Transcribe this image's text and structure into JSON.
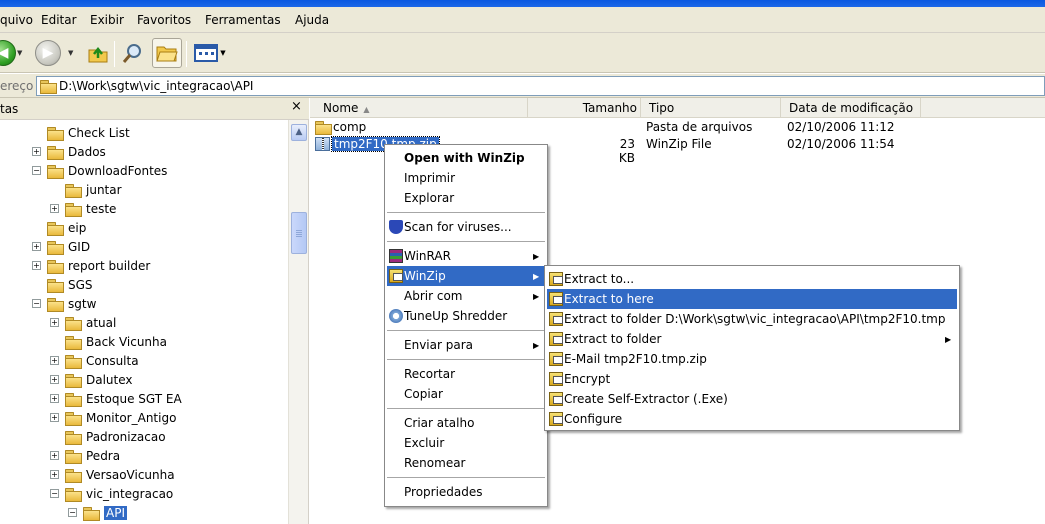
{
  "menubar": {
    "items": [
      "quivo",
      "Editar",
      "Exibir",
      "Favoritos",
      "Ferramentas",
      "Ajuda"
    ]
  },
  "toolbar": {
    "icons": [
      "back-icon",
      "forward-icon",
      "up-folder-icon",
      "search-icon",
      "folders-icon",
      "views-icon"
    ]
  },
  "address": {
    "label": "ereço",
    "value": "D:\\Work\\sgtw\\vic_integracao\\API"
  },
  "left_pane": {
    "title": "tas",
    "close_glyph": "×",
    "tree": [
      {
        "label": "Check List",
        "level": 0,
        "expander": ""
      },
      {
        "label": "Dados",
        "level": 0,
        "expander": "+"
      },
      {
        "label": "DownloadFontes",
        "level": 0,
        "expander": "−"
      },
      {
        "label": "juntar",
        "level": 1,
        "expander": ""
      },
      {
        "label": "teste",
        "level": 1,
        "expander": "+"
      },
      {
        "label": "eip",
        "level": 0,
        "expander": ""
      },
      {
        "label": "GID",
        "level": 0,
        "expander": "+"
      },
      {
        "label": "report builder",
        "level": 0,
        "expander": "+"
      },
      {
        "label": "SGS",
        "level": 0,
        "expander": ""
      },
      {
        "label": "sgtw",
        "level": 0,
        "expander": "−"
      },
      {
        "label": "atual",
        "level": 1,
        "expander": "+"
      },
      {
        "label": "Back Vicunha",
        "level": 1,
        "expander": ""
      },
      {
        "label": "Consulta",
        "level": 1,
        "expander": "+"
      },
      {
        "label": "Dalutex",
        "level": 1,
        "expander": "+"
      },
      {
        "label": "Estoque SGT EA",
        "level": 1,
        "expander": "+"
      },
      {
        "label": "Monitor_Antigo",
        "level": 1,
        "expander": "+"
      },
      {
        "label": "Padronizacao",
        "level": 1,
        "expander": ""
      },
      {
        "label": "Pedra",
        "level": 1,
        "expander": "+"
      },
      {
        "label": "VersaoVicunha",
        "level": 1,
        "expander": "+"
      },
      {
        "label": "vic_integracao",
        "level": 1,
        "expander": "−"
      },
      {
        "label": "API",
        "level": 2,
        "expander": "−",
        "selected": true
      }
    ]
  },
  "file_list": {
    "columns": [
      "Nome",
      "Tamanho",
      "Tipo",
      "Data de modificação"
    ],
    "rows": [
      {
        "name": "comp",
        "size": "",
        "type": "Pasta de arquivos",
        "date": "02/10/2006 11:12"
      },
      {
        "name": "tmp2F10.tmp.zip",
        "size": "23 KB",
        "type": "WinZip File",
        "date": "02/10/2006 11:54"
      }
    ]
  },
  "context_menu": {
    "items": [
      {
        "label": "Open with WinZip",
        "bold": true
      },
      {
        "label": "Imprimir"
      },
      {
        "label": "Explorar"
      },
      {
        "sep": true
      },
      {
        "label": "Scan for viruses...",
        "icon": "shield-icon"
      },
      {
        "sep": true
      },
      {
        "label": "WinRAR",
        "icon": "winrar-icon",
        "submenu": true
      },
      {
        "label": "WinZip",
        "icon": "winzip-icon",
        "submenu": true,
        "highlight": true
      },
      {
        "label": "Abrir com",
        "submenu": true
      },
      {
        "label": "TuneUp Shredder",
        "icon": "tuneup-icon"
      },
      {
        "sep": true
      },
      {
        "label": "Enviar para",
        "submenu": true
      },
      {
        "sep": true
      },
      {
        "label": "Recortar"
      },
      {
        "label": "Copiar"
      },
      {
        "sep": true
      },
      {
        "label": "Criar atalho"
      },
      {
        "label": "Excluir"
      },
      {
        "label": "Renomear"
      },
      {
        "sep": true
      },
      {
        "label": "Propriedades"
      }
    ]
  },
  "winzip_submenu": {
    "items": [
      {
        "label": "Extract to..."
      },
      {
        "label": "Extract to here",
        "highlight": true
      },
      {
        "label": "Extract to folder D:\\Work\\sgtw\\vic_integracao\\API\\tmp2F10.tmp"
      },
      {
        "label": "Extract to folder",
        "submenu": true
      },
      {
        "label": "E-Mail tmp2F10.tmp.zip"
      },
      {
        "label": "Encrypt"
      },
      {
        "label": "Create Self-Extractor (.Exe)"
      },
      {
        "label": "Configure"
      }
    ]
  },
  "colors": {
    "highlight": "#316ac5",
    "chrome": "#ece9d8"
  }
}
